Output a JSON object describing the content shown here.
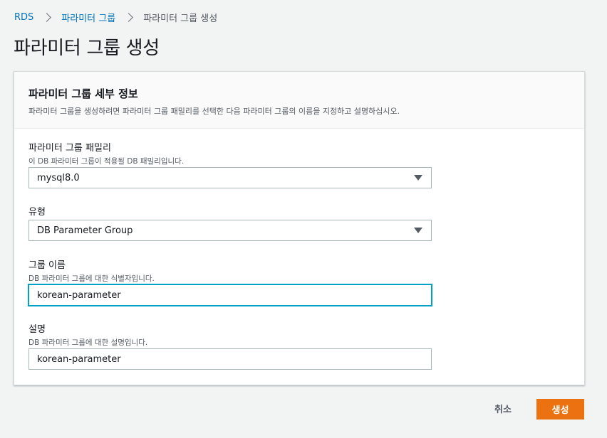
{
  "breadcrumb": {
    "root": "RDS",
    "parent": "파라미터 그룹",
    "current": "파라미터 그룹 생성"
  },
  "page": {
    "title": "파라미터 그룹 생성"
  },
  "panel": {
    "title": "파라미터 그룹 세부 정보",
    "description": "파라미터 그룹을 생성하려면 파라미터 그룹 패밀리를 선택한 다음 파라미터 그룹의 이름을 지정하고 설명하십시오."
  },
  "fields": {
    "family": {
      "label": "파라미터 그룹 패밀리",
      "description": "이 DB 파라미터 그룹이 적용될 DB 패밀리입니다.",
      "value": "mysql8.0"
    },
    "type": {
      "label": "유형",
      "value": "DB Parameter Group"
    },
    "group_name": {
      "label": "그룹 이름",
      "description": "DB 파라미터 그룹에 대한 식별자입니다.",
      "value": "korean-parameter"
    },
    "description": {
      "label": "설명",
      "description": "DB 파라미터 그룹에 대한 설명입니다.",
      "value": "korean-parameter"
    }
  },
  "actions": {
    "cancel_label": "취소",
    "create_label": "생성"
  },
  "colors": {
    "primary": "#ec7211",
    "link": "#0073bb",
    "focus": "#00a1c9"
  }
}
